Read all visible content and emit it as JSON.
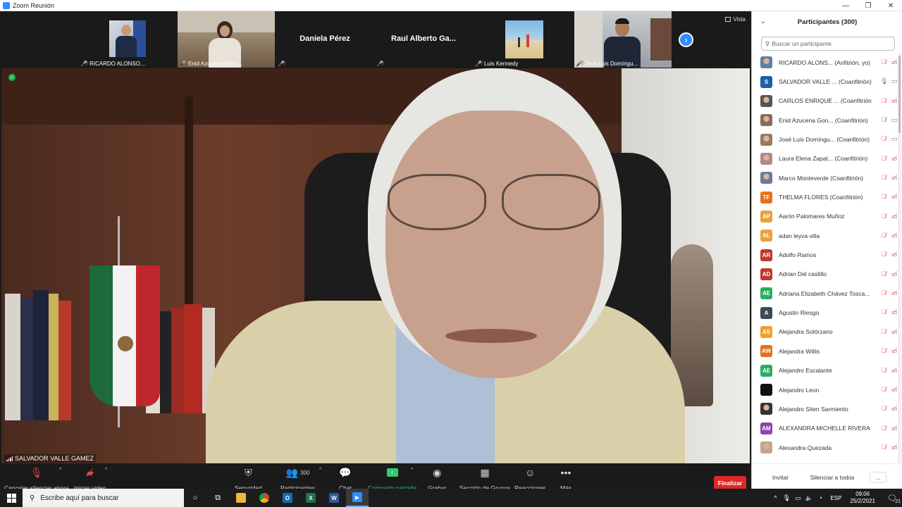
{
  "window": {
    "title": "Zoom Reunión",
    "buttons": [
      "—",
      "❐",
      "✕"
    ]
  },
  "strip": {
    "view_label": "Vista",
    "thumbs": [
      {
        "name": "RICARDO ALONSO..."
      },
      {
        "name": "Enid Azucena Gonz..."
      },
      {
        "name": "",
        "center": "Daniela Pérez"
      },
      {
        "name": "",
        "center": "Raul Alberto Ga..."
      },
      {
        "name": "Luis Kennedy"
      },
      {
        "name": "José Luis Domíngu..."
      }
    ]
  },
  "speaker": {
    "name": "SALVADOR VALLE GAMEZ"
  },
  "toolbar": {
    "mute_label": "Cancelar silenciar ahora",
    "video_label": "Iniciar video",
    "security_label": "Seguridad",
    "participants_label": "Participantes",
    "participants_count": "300",
    "chat_label": "Chat",
    "share_label": "Compartir pantalla",
    "record_label": "Grabar",
    "breakout_label": "Sección de Grupos",
    "reactions_label": "Reacciones",
    "more_label": "Más",
    "end_label": "Finalizar"
  },
  "panel": {
    "title": "Participantes (300)",
    "search_placeholder": "Buscar un participante",
    "invite_label": "Invitar",
    "mute_all_label": "Silenciar a todos",
    "more_label": "...",
    "participants": [
      {
        "name": "RICARDO ALONS...  (Anfitrión, yo)",
        "initials": "",
        "color": "#5d7fa8",
        "photo": true,
        "mic": "muted",
        "cam": "off"
      },
      {
        "name": "SALVADOR VALLE ...  (Coanfitrión)",
        "initials": "S",
        "color": "#1e5fa8",
        "photo": false,
        "mic": "on",
        "cam": "on"
      },
      {
        "name": "CARLOS ENRIQUE ...  (Coanfitrión)",
        "initials": "",
        "color": "#555555",
        "photo": true,
        "mic": "muted",
        "cam": "off"
      },
      {
        "name": "Enid Azucena Gon...  (Coanfitrión)",
        "initials": "",
        "color": "#8a6a5a",
        "photo": true,
        "mic": "muted",
        "cam": "on"
      },
      {
        "name": "José Luis Domíngu...  (Coanfitrión)",
        "initials": "",
        "color": "#9a7a5a",
        "photo": true,
        "mic": "muted",
        "cam": "on"
      },
      {
        "name": "Laura Elena Zapat...  (Coanfitrión)",
        "initials": "",
        "color": "#b08a80",
        "photo": true,
        "mic": "muted",
        "cam": "off"
      },
      {
        "name": "Marco Monteverde (Coanfitrión)",
        "initials": "",
        "color": "#6a7a9a",
        "photo": true,
        "mic": "muted",
        "cam": "off"
      },
      {
        "name": "THELMA FLORES (Coanfitrión)",
        "initials": "TF",
        "color": "#e4721c",
        "photo": false,
        "mic": "muted",
        "cam": "off"
      },
      {
        "name": "Aarón Palomares Muñoz",
        "initials": "AP",
        "color": "#e9a23b",
        "photo": false,
        "mic": "muted",
        "cam": "off"
      },
      {
        "name": "adan leyva villa",
        "initials": "AL",
        "color": "#e9a23b",
        "photo": false,
        "mic": "muted",
        "cam": "off"
      },
      {
        "name": "Adolfo Ramos",
        "initials": "AR",
        "color": "#c0392b",
        "photo": false,
        "mic": "muted",
        "cam": "off"
      },
      {
        "name": "Adrian Del castillo",
        "initials": "AD",
        "color": "#c0392b",
        "photo": false,
        "mic": "muted",
        "cam": "off"
      },
      {
        "name": "Adriana Elizabeth Chávez Tosca...",
        "initials": "AE",
        "color": "#27ae60",
        "photo": false,
        "mic": "muted",
        "cam": "off"
      },
      {
        "name": "Agustin Riesgo",
        "initials": "A",
        "color": "#3d4a5c",
        "photo": false,
        "mic": "muted",
        "cam": "off"
      },
      {
        "name": "Alejandra Solórzano",
        "initials": "AS",
        "color": "#f0a12b",
        "photo": false,
        "mic": "muted",
        "cam": "off"
      },
      {
        "name": "Alejandra Willis",
        "initials": "AW",
        "color": "#e4721c",
        "photo": false,
        "mic": "muted",
        "cam": "off"
      },
      {
        "name": "Alejandro Escalante",
        "initials": "AE",
        "color": "#27ae60",
        "photo": false,
        "mic": "muted",
        "cam": "off"
      },
      {
        "name": "Alejandro Leon",
        "initials": "",
        "color": "#111111",
        "photo": false,
        "mic": "muted",
        "cam": "off"
      },
      {
        "name": "Alejandro Siten Sarmiento",
        "initials": "",
        "color": "#333333",
        "photo": true,
        "mic": "muted",
        "cam": "off"
      },
      {
        "name": "ALEXANDRA MICHELLE RIVERA ...",
        "initials": "AM",
        "color": "#8e44ad",
        "photo": false,
        "mic": "muted",
        "cam": "off"
      },
      {
        "name": "Alexandra Quezada",
        "initials": "",
        "color": "#c9a28a",
        "photo": true,
        "mic": "muted",
        "cam": "off"
      }
    ]
  },
  "taskbar": {
    "search_placeholder": "Escribe aquí para buscar",
    "lang": "ESP",
    "time": "09:06",
    "date": "25/2/2021",
    "notif_count": "21"
  }
}
